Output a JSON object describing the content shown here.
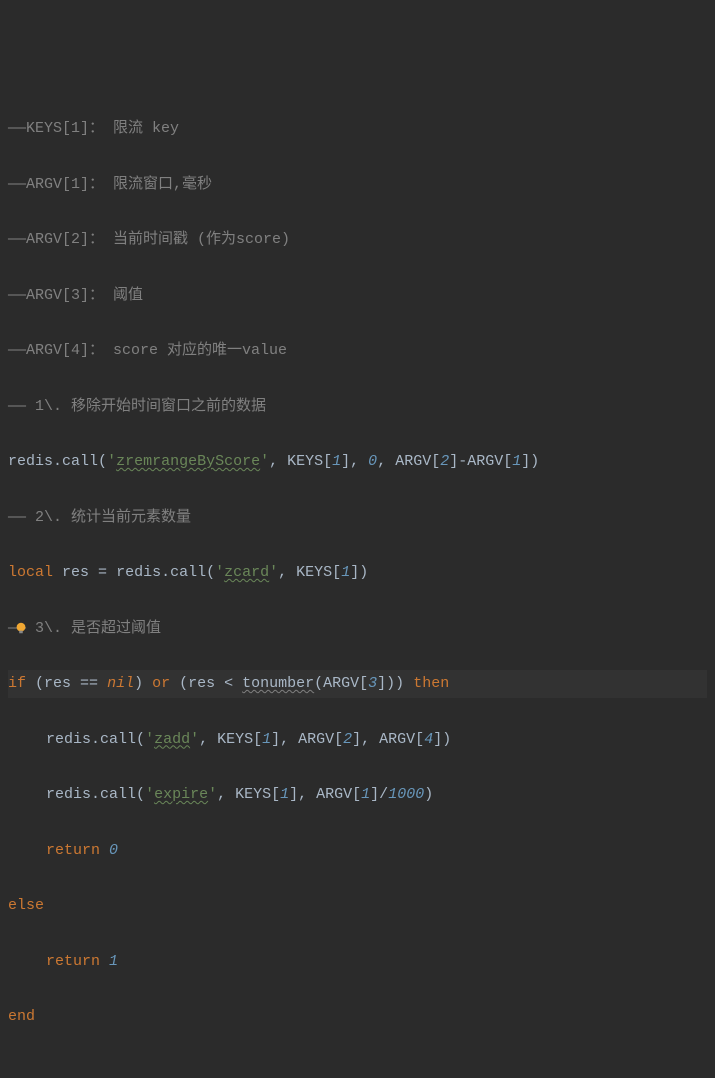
{
  "chart_data": null,
  "code": {
    "c1": "——KEYS[1]： 限流 key",
    "c2": "——ARGV[1]： 限流窗口,毫秒",
    "c3": "——ARGV[2]： 当前时间戳 (作为score)",
    "c4": "——ARGV[3]： 阈值",
    "c5": "——ARGV[4]： score 对应的唯一value",
    "c6": "—— 1\\. 移除开始时间窗口之前的数据",
    "l7": {
      "redis": "redis",
      "dot": ".",
      "call": "call",
      "op": "(",
      "q": "'",
      "s": "zremrangeByScore",
      "cp": ", KEYS[",
      "k1": "1",
      "mid": "], ",
      "zero": "0",
      "mid2": ", ARGV[",
      "a2": "2",
      "mid3": "]-ARGV[",
      "a1": "1",
      "end": "])"
    },
    "c8": "—— 2\\. 统计当前元素数量",
    "l9": {
      "lcl": "local",
      "res": " res ",
      "eq": "=",
      "sp": " ",
      "redis": "redis",
      "dot": ".",
      "call": "call",
      "op": "(",
      "q": "'",
      "s": "zcard",
      "mid": ", KEYS[",
      "k1": "1",
      "end": "])"
    },
    "c10": "—— 3\\. 是否超过阈值",
    "l11": {
      "if": "if",
      "op": " (res ",
      "eqeq": "==",
      "sp": " ",
      "nil": "nil",
      "cp": ") ",
      "or": "or",
      "op2": " (res < ",
      "fn": "tonumber",
      "mid": "(ARGV[",
      "a3": "3",
      "end": "])) ",
      "then": "then"
    },
    "l12": {
      "redis": "redis",
      "dot": ".",
      "call": "call",
      "op": "(",
      "q": "'",
      "s": "zadd",
      "mid": ", KEYS[",
      "k1": "1",
      "m2": "], ARGV[",
      "a2": "2",
      "m3": "], ARGV[",
      "a4": "4",
      "end": "])"
    },
    "l13": {
      "redis": "redis",
      "dot": ".",
      "call": "call",
      "op": "(",
      "q": "'",
      "s": "expire",
      "mid": ", KEYS[",
      "k1": "1",
      "m2": "], ARGV[",
      "a1": "1",
      "m3": "]/",
      "th": "1000",
      "end": ")"
    },
    "l14": {
      "ret": "return",
      "sp": " ",
      "v": "0"
    },
    "l15": {
      "else": "else"
    },
    "l16": {
      "ret": "return",
      "sp": " ",
      "v": "1"
    },
    "l17": {
      "end": "end"
    }
  }
}
